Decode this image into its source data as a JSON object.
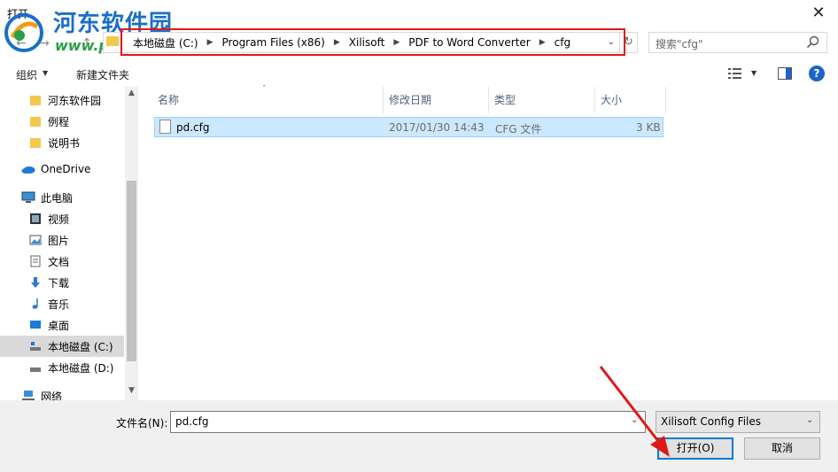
{
  "window": {
    "title": "打开",
    "close_symbol": "✕"
  },
  "watermark": {
    "text": "河东软件园",
    "url": "www.pc0359.cn"
  },
  "nav": {
    "back": "←",
    "forward": "→",
    "up": "↑"
  },
  "address": {
    "crumbs": [
      "本地磁盘 (C:)",
      "Program Files (x86)",
      "Xilisoft",
      "PDF to Word Converter",
      "cfg"
    ],
    "dropdown": "⌄",
    "refresh": "↻"
  },
  "search": {
    "placeholder": "搜索\"cfg\""
  },
  "toolbar": {
    "organize": "组织",
    "new_folder": "新建文件夹",
    "help": "?"
  },
  "sidebar": {
    "items": [
      {
        "label": "河东软件园",
        "icon": "folder-icon"
      },
      {
        "label": "例程",
        "icon": "folder-icon"
      },
      {
        "label": "说明书",
        "icon": "folder-icon"
      },
      {
        "label": "OneDrive",
        "icon": "cloud-icon"
      },
      {
        "label": "此电脑",
        "icon": "computer-icon"
      },
      {
        "label": "视频",
        "icon": "video-icon"
      },
      {
        "label": "图片",
        "icon": "picture-icon"
      },
      {
        "label": "文档",
        "icon": "document-icon"
      },
      {
        "label": "下载",
        "icon": "download-icon"
      },
      {
        "label": "音乐",
        "icon": "music-icon"
      },
      {
        "label": "桌面",
        "icon": "desktop-icon"
      },
      {
        "label": "本地磁盘 (C:)",
        "icon": "drive-icon",
        "selected": true
      },
      {
        "label": "本地磁盘 (D:)",
        "icon": "drive-icon"
      },
      {
        "label": "网络",
        "icon": "network-icon"
      }
    ]
  },
  "columns": {
    "name": "名称",
    "date": "修改日期",
    "type": "类型",
    "size": "大小"
  },
  "files": [
    {
      "name": "pd.cfg",
      "date": "2017/01/30 14:43",
      "type": "CFG 文件",
      "size": "3 KB"
    }
  ],
  "bottom": {
    "filename_label": "文件名(N):",
    "filename_value": "pd.cfg",
    "filter_value": "Xilisoft Config Files",
    "open_label": "打开(O)",
    "cancel_label": "取消"
  },
  "colors": {
    "highlight": "#e01818",
    "selection": "#cce8ff",
    "accent": "#0078d7"
  }
}
